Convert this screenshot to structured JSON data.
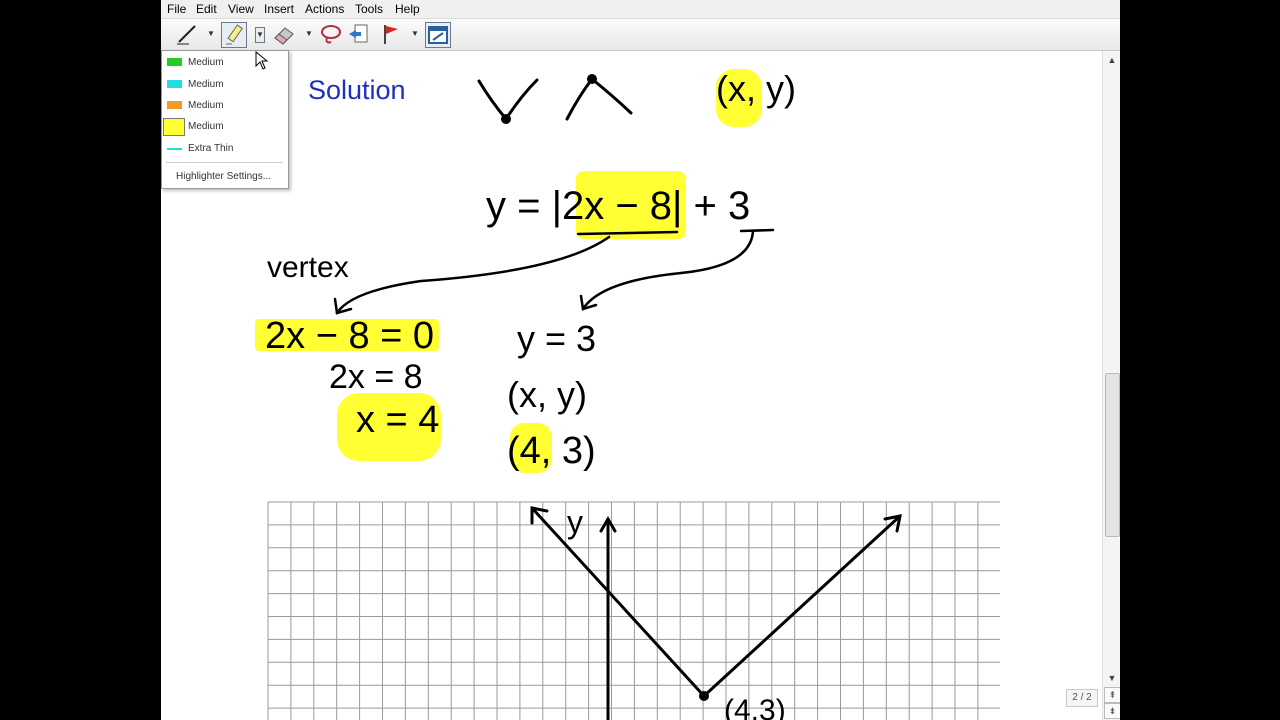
{
  "menu": [
    "File",
    "Edit",
    "View",
    "Insert",
    "Actions",
    "Tools",
    "Help"
  ],
  "toolbar": {
    "tools": [
      "pen-icon",
      "highlighter-icon",
      "eraser-icon",
      "lasso-icon",
      "insert-page-icon",
      "flag-icon",
      "screen-capture-icon"
    ]
  },
  "highlighter_menu": {
    "items": [
      {
        "label": "Medium",
        "color": "#22cc22"
      },
      {
        "label": "Medium",
        "color": "#22dddd"
      },
      {
        "label": "Medium",
        "color": "#f39a22"
      },
      {
        "label": "Medium",
        "color": "#ffff33"
      },
      {
        "label": "Extra Thin",
        "color": "#22dddd"
      }
    ],
    "settings_label": "Highlighter Settings..."
  },
  "notes": {
    "heading": "Solution",
    "pair_top": "(x, y)",
    "equation": "y = |2x − 8| + 3",
    "vertex_label": "vertex",
    "step1": "2x − 8 = 0",
    "step2": "2x = 8",
    "step3": "x = 4",
    "ystep": "y = 3",
    "pair": "(x, y)",
    "result": "(4, 3)",
    "graph_axis_label": "y",
    "graph_point_label": "(4,3)"
  },
  "colors": {
    "highlight": "#ffff33",
    "ink": "#000000",
    "heading": "#1d2fbf",
    "grid": "#9a9a9a"
  },
  "status": {
    "page_counter": "2 / 2"
  }
}
